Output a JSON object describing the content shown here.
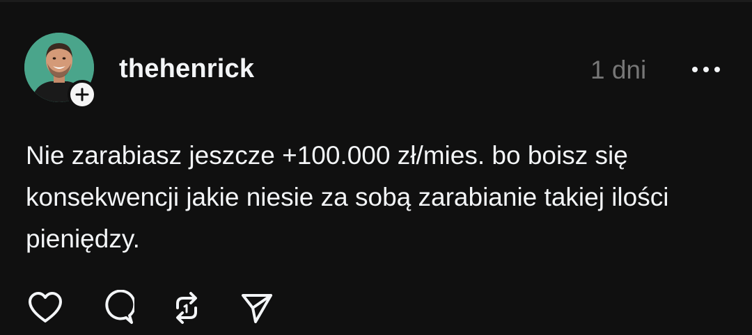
{
  "post": {
    "author": {
      "username": "thehenrick",
      "avatar_icon": "profile-photo",
      "follow_icon": "plus-icon"
    },
    "timestamp": "1 dni",
    "more_icon": "ellipsis-icon",
    "text": "Nie zarabiasz jeszcze +100.000 zł/mies. bo boisz się konsekwencji jakie niesie za sobą zarabianie takiej ilości pieniędzy.",
    "actions": [
      {
        "name": "like",
        "icon": "heart-icon"
      },
      {
        "name": "reply",
        "icon": "comment-icon"
      },
      {
        "name": "repost",
        "icon": "repost-icon"
      },
      {
        "name": "share",
        "icon": "send-icon"
      }
    ]
  },
  "theme": {
    "background": "#101010",
    "text_primary": "#f3f5f7",
    "text_secondary": "#777777",
    "avatar_bg": "#4aa58b"
  }
}
